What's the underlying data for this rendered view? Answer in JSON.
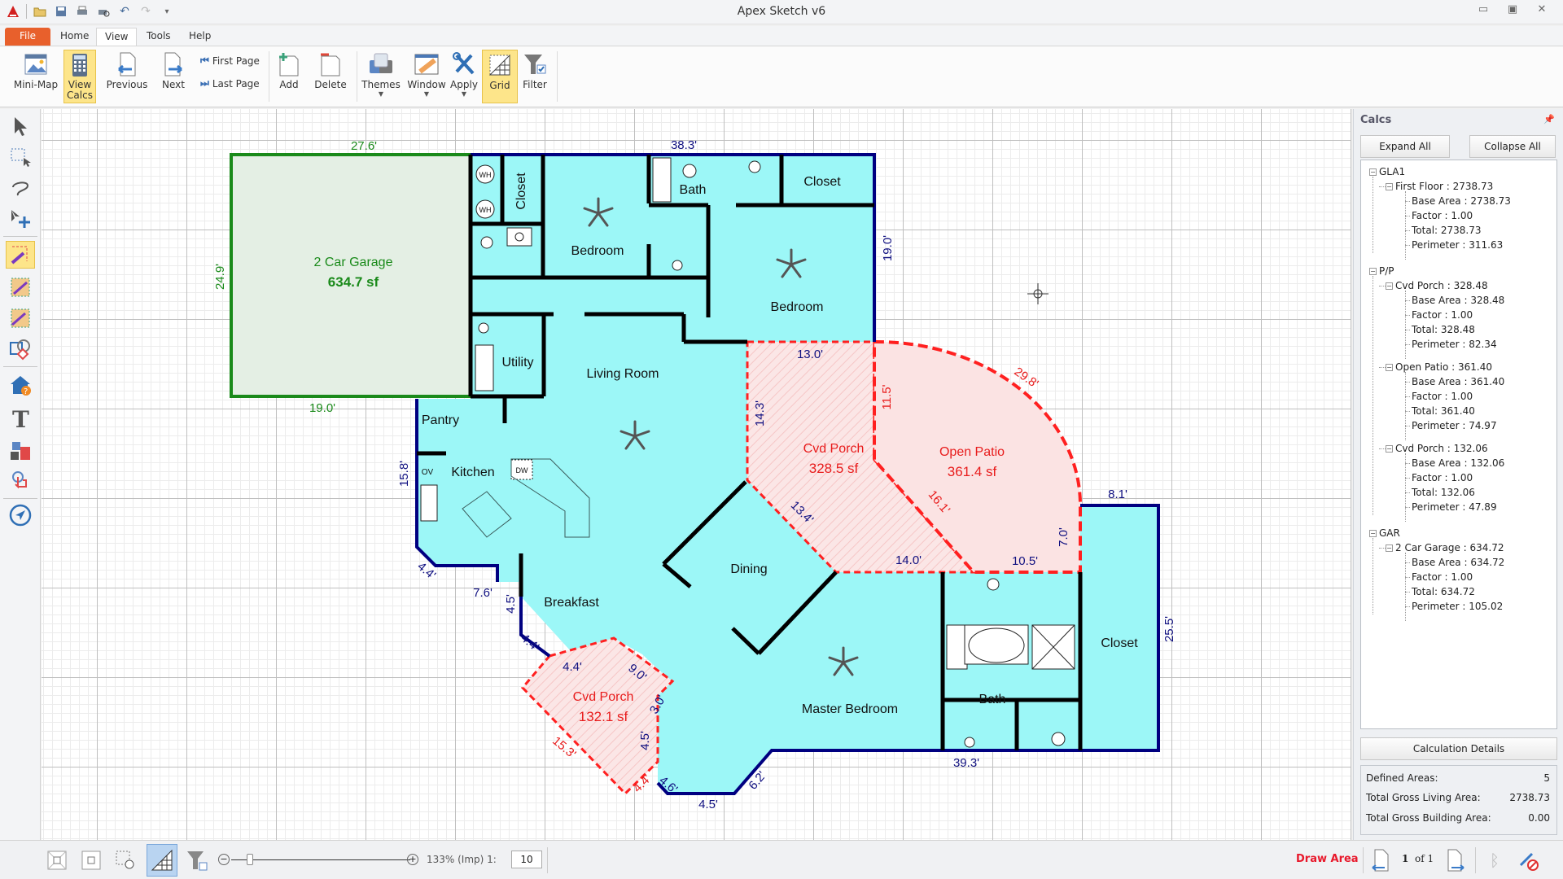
{
  "app": {
    "title": "Apex Sketch v6"
  },
  "ribbon": {
    "tabs": [
      "File",
      "Home",
      "View",
      "Tools",
      "Help"
    ],
    "active_tab": "View",
    "buttons": {
      "minimap": "Mini-Map",
      "view_calcs": "View Calcs",
      "previous": "Previous",
      "next": "Next",
      "first_page": "First Page",
      "last_page": "Last Page",
      "add": "Add",
      "delete": "Delete",
      "themes": "Themes",
      "window": "Window",
      "apply": "Apply",
      "grid": "Grid",
      "filter": "Filter"
    }
  },
  "toolbox": [
    "select-arrow",
    "rectangle-select",
    "lasso",
    "move",
    "draw-area",
    "edit-area",
    "split-area",
    "shapes",
    "house-help",
    "text",
    "symbols-library",
    "touch",
    "navigate"
  ],
  "sketch": {
    "rooms": {
      "garage_name": "2 Car Garage",
      "garage_area": "634.7 sf",
      "closet1": "Closet",
      "bedroom1": "Bedroom",
      "bath1": "Bath",
      "closet2": "Closet",
      "bedroom2": "Bedroom",
      "utility": "Utility",
      "living": "Living Room",
      "pantry": "Pantry",
      "kitchen": "Kitchen",
      "dining": "Dining",
      "breakfast": "Breakfast",
      "master": "Master Bedroom",
      "bath2": "Bath",
      "closet3": "Closet",
      "porch1_name": "Cvd Porch",
      "porch1_area": "328.5 sf",
      "patio_name": "Open Patio",
      "patio_area": "361.4 sf",
      "porch2_name": "Cvd Porch",
      "porch2_area": "132.1 sf",
      "wh": "WH",
      "ov": "OV",
      "dw": "DW"
    },
    "dims": {
      "garage_top": "27.6'",
      "garage_left": "24.9'",
      "garage_bottom": "19.0'",
      "house_top": "38.3'",
      "house_right_upper": "19.0'",
      "porch_top": "13.0'",
      "porch_left": "14.3'",
      "porch_mid": "11.5'",
      "patio_arc": "29.8'",
      "patio_diag": "16.1'",
      "porch_diag": "13.4'",
      "porch_bottom": "14.0'",
      "patio_bottom": "10.5'",
      "patio_right": "7.0'",
      "closet_top": "8.1'",
      "right_side": "25.5'",
      "bottom_right": "39.3'",
      "kitchen_left": "15.8'",
      "kitchen_corner": "4.4'",
      "kitchen_bottom": "7.6'",
      "breakfast_left": "4.5'",
      "breakfast_diag": "4.4'",
      "porch2_top": "4.4'",
      "porch2_diag": "9.0'",
      "porch2_short": "3.0'",
      "porch2_side": "4.5'",
      "porch2_long": "15.3'",
      "porch2_bottom": "4.4'",
      "bottom_diag1": "4.6'",
      "bottom_mid": "4.5'",
      "bottom_diag2": "6.2'"
    }
  },
  "calcs": {
    "title": "Calcs",
    "expand_all": "Expand All",
    "collapse_all": "Collapse All",
    "groups": [
      {
        "name": "GLA1",
        "areas": [
          {
            "name": "First Floor : 2738.73",
            "details": [
              "Base Area : 2738.73",
              "Factor : 1.00",
              "Total: 2738.73",
              "Perimeter : 311.63"
            ]
          }
        ]
      },
      {
        "name": "P/P",
        "areas": [
          {
            "name": "Cvd Porch : 328.48",
            "details": [
              "Base Area : 328.48",
              "Factor : 1.00",
              "Total: 328.48",
              "Perimeter : 82.34"
            ]
          },
          {
            "name": "Open Patio : 361.40",
            "details": [
              "Base Area : 361.40",
              "Factor : 1.00",
              "Total: 361.40",
              "Perimeter : 74.97"
            ]
          },
          {
            "name": "Cvd Porch : 132.06",
            "details": [
              "Base Area : 132.06",
              "Factor : 1.00",
              "Total: 132.06",
              "Perimeter : 47.89"
            ]
          }
        ]
      },
      {
        "name": "GAR",
        "areas": [
          {
            "name": "2 Car Garage : 634.72",
            "details": [
              "Base Area : 634.72",
              "Factor : 1.00",
              "Total: 634.72",
              "Perimeter : 105.02"
            ]
          }
        ]
      }
    ],
    "calc_details": "Calculation Details",
    "summary": [
      {
        "label": "Defined Areas:",
        "value": "5"
      },
      {
        "label": "Total Gross Living Area:",
        "value": "2738.73"
      },
      {
        "label": "Total Gross Building Area:",
        "value": "0.00"
      }
    ]
  },
  "status": {
    "zoom": "133% (Imp) 1:",
    "scale": "10",
    "zoom_slider_fraction": 0.09,
    "mode": "Draw Area",
    "page_current": "1",
    "page_of": "of 1"
  },
  "colors": {
    "living": "#9cf7f7",
    "garage": "#e4efe4",
    "porch": "#fbe3e3",
    "wall": "#000000",
    "exterior": "#000080",
    "garage_line": "#1a8a1a",
    "porch_line": "#ff2020",
    "accent_selected": "#fde58a",
    "mode_text": "#e8192c"
  }
}
